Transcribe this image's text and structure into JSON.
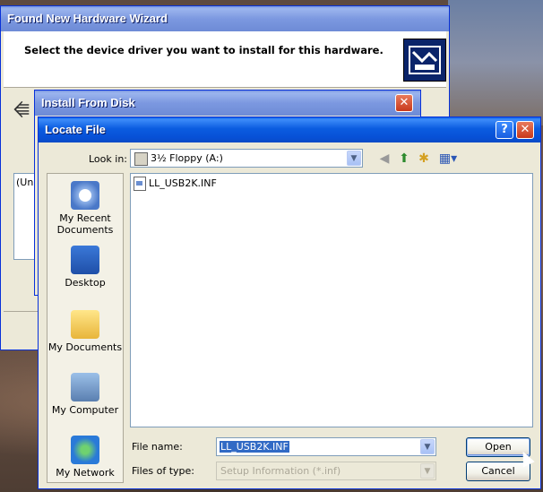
{
  "wizard": {
    "title": "Found New Hardware Wizard",
    "header_text": "Select the device driver you want to install for this hardware.",
    "list_fragment": "(Una"
  },
  "install_from_disk": {
    "title": "Install From Disk",
    "close_glyph": "✕"
  },
  "locate_file": {
    "title": "Locate File",
    "help_glyph": "?",
    "close_glyph": "✕",
    "look_in_label": "Look in:",
    "look_in_value": "3½ Floppy (A:)",
    "files": [
      "LL_USB2K.INF"
    ],
    "places": [
      {
        "label_1": "My Recent",
        "label_2": "Documents",
        "icon": "recent-documents-icon"
      },
      {
        "label_1": "Desktop",
        "label_2": "",
        "icon": "desktop-icon"
      },
      {
        "label_1": "My Documents",
        "label_2": "",
        "icon": "my-documents-icon"
      },
      {
        "label_1": "My Computer",
        "label_2": "",
        "icon": "my-computer-icon"
      },
      {
        "label_1": "My Network",
        "label_2": "",
        "icon": "my-network-icon"
      }
    ],
    "file_name_label": "File name:",
    "file_name_value": "LL_USB2K.INF",
    "files_of_type_label": "Files of type:",
    "files_of_type_value": "Setup Information (*.inf)",
    "open_label": "Open",
    "cancel_label": "Cancel"
  },
  "colors": {
    "title_active": "#0a5fe8",
    "title_inactive": "#7a96df",
    "dialog_face": "#ece9d8",
    "selection": "#316ac5"
  }
}
